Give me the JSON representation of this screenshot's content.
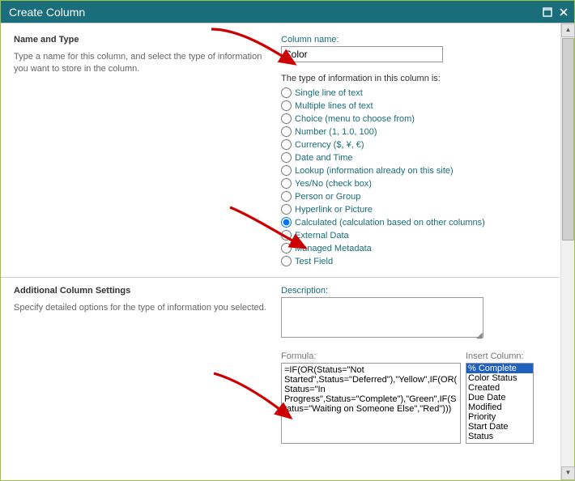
{
  "dialog": {
    "title": "Create Column"
  },
  "sections": {
    "nameType": {
      "heading": "Name and Type",
      "description": "Type a name for this column, and select the type of information you want to store in the column."
    },
    "additional": {
      "heading": "Additional Column Settings",
      "description": "Specify detailed options for the type of information you selected."
    }
  },
  "column": {
    "name_label": "Column name:",
    "name_value": "Color",
    "type_header": "The type of information in this column is:",
    "types": [
      "Single line of text",
      "Multiple lines of text",
      "Choice (menu to choose from)",
      "Number (1, 1.0, 100)",
      "Currency ($, ¥, €)",
      "Date and Time",
      "Lookup (information already on this site)",
      "Yes/No (check box)",
      "Person or Group",
      "Hyperlink or Picture",
      "Calculated (calculation based on other columns)",
      "External Data",
      "Managed Metadata",
      "Test Field"
    ],
    "selected_type_index": 10
  },
  "additional": {
    "description_label": "Description:",
    "description_value": "",
    "formula_label": "Formula:",
    "formula_value": "=IF(OR(Status=\"Not Started\",Status=\"Deferred\"),\"Yellow\",IF(OR(Status=\"In Progress\",Status=\"Complete\"),\"Green\",IF(Status=\"Waiting on Someone Else\",\"Red\")))",
    "insert_label": "Insert Column:",
    "insert_columns": [
      "% Complete",
      "Color Status",
      "Created",
      "Due Date",
      "Modified",
      "Priority",
      "Start Date",
      "Status"
    ],
    "insert_selected_index": 0
  }
}
